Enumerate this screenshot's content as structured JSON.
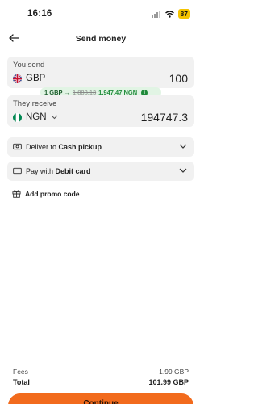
{
  "status_bar": {
    "time": "16:16",
    "battery": "87",
    "signal_icon": "signal-bars-icon",
    "wifi_icon": "wifi-icon"
  },
  "header": {
    "title": "Send money",
    "back_icon": "arrow-left-icon"
  },
  "send": {
    "label": "You send",
    "currency": "GBP",
    "flag": "uk-flag-icon",
    "amount": "100"
  },
  "rate": {
    "label": "1 GBP →",
    "old_rate": "1,888.13",
    "new_rate": "1,947.47 NGN",
    "info_icon": "info-icon",
    "color_bg": "#e1f4e4",
    "color_text": "#1f8a3a"
  },
  "receive": {
    "label": "They receive",
    "currency": "NGN",
    "flag": "nigeria-flag-icon",
    "amount": "194747.3"
  },
  "delivery": {
    "prefix": "Deliver to",
    "method": "Cash pickup",
    "icon": "cash-icon"
  },
  "payment": {
    "prefix": "Pay with",
    "method": "Debit card",
    "icon": "card-icon"
  },
  "promo": {
    "label": "Add promo code",
    "icon": "gift-icon"
  },
  "summary": {
    "fees_label": "Fees",
    "fees_value": "1.99 GBP",
    "total_label": "Total",
    "total_value": "101.99 GBP"
  },
  "cta": {
    "label": "Continue",
    "color": "#f26b1d"
  }
}
